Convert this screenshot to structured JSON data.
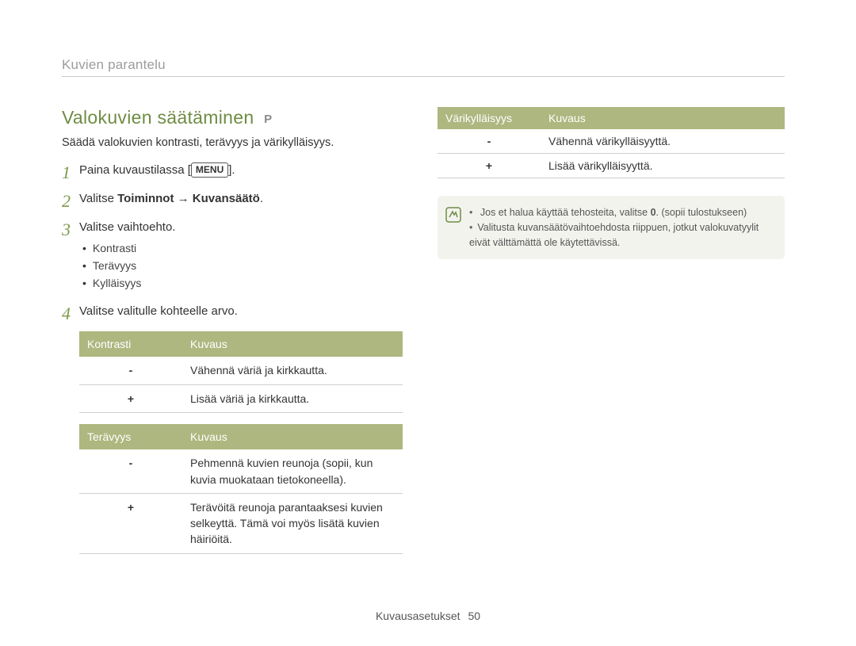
{
  "breadcrumb": "Kuvien parantelu",
  "title": "Valokuvien säätäminen",
  "mode_badge": "P",
  "intro": "Säädä valokuvien kontrasti, terävyys ja värikylläisyys.",
  "menu_label": "MENU",
  "steps": {
    "s1_pre": "Paina kuvaustilassa [",
    "s1_post": "].",
    "s2_pre": "Valitse ",
    "s2_b1": "Toiminnot",
    "s2_arrow": " → ",
    "s2_b2": "Kuvansäätö",
    "s2_post": ".",
    "s3": "Valitse vaihtoehto.",
    "s4": "Valitse valitulle kohteelle arvo."
  },
  "suboptions": [
    "Kontrasti",
    "Terävyys",
    "Kylläisyys"
  ],
  "tables": {
    "kontrasti": {
      "h1": "Kontrasti",
      "h2": "Kuvaus",
      "rows": [
        {
          "sym": "-",
          "desc": "Vähennä väriä ja kirkkautta."
        },
        {
          "sym": "+",
          "desc": "Lisää väriä ja kirkkautta."
        }
      ]
    },
    "teravyys": {
      "h1": "Terävyys",
      "h2": "Kuvaus",
      "rows": [
        {
          "sym": "-",
          "desc": "Pehmennä kuvien reunoja (sopii, kun kuvia muokataan tietokoneella)."
        },
        {
          "sym": "+",
          "desc": "Terävöitä reunoja parantaaksesi kuvien selkeyttä. Tämä voi myös lisätä kuvien häiriöitä."
        }
      ]
    },
    "varikyllaisyys": {
      "h1": "Värikylläisyys",
      "h2": "Kuvaus",
      "rows": [
        {
          "sym": "-",
          "desc": "Vähennä värikylläisyyttä."
        },
        {
          "sym": "+",
          "desc": "Lisää värikylläisyyttä."
        }
      ]
    }
  },
  "note": {
    "l1_pre": "Jos et halua käyttää tehosteita, valitse ",
    "l1_b": "0",
    "l1_post": ". (sopii tulostukseen)",
    "l2": "Valitusta kuvansäätövaihtoehdosta riippuen, jotkut valokuvatyylit eivät välttämättä ole käytettävissä."
  },
  "footer": {
    "section": "Kuvausasetukset",
    "page": "50"
  }
}
